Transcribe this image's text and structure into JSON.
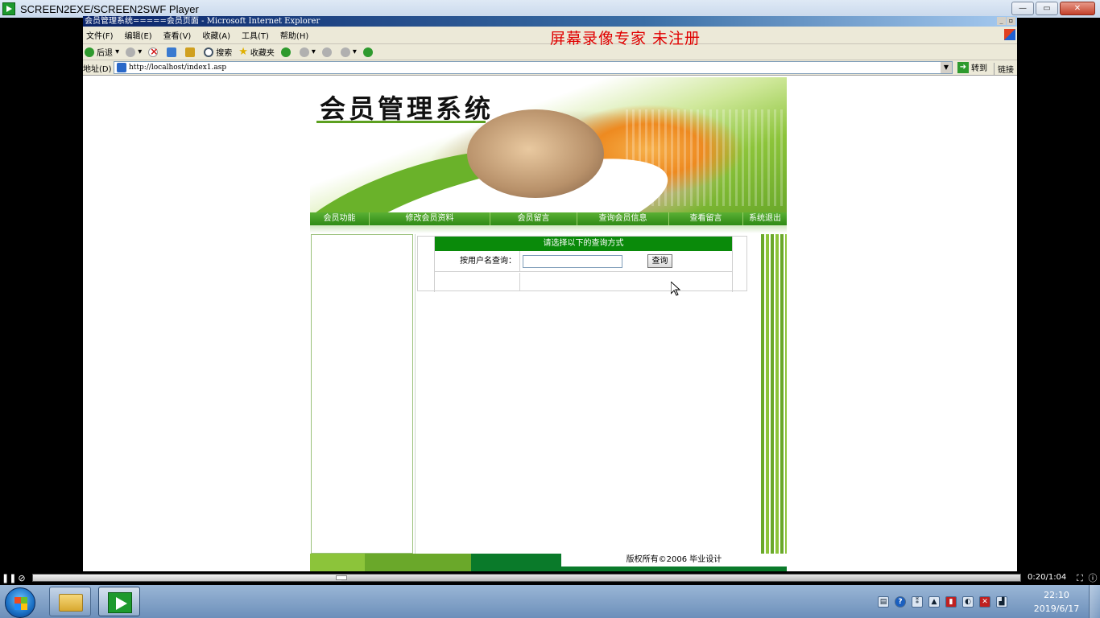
{
  "player": {
    "title": "SCREEN2EXE/SCREEN2SWF Player",
    "time": "0:20/1:04",
    "progress": 0.3125
  },
  "ie": {
    "title": "会员管理系统=====会员页面 - Microsoft Internet Explorer",
    "menu": [
      "文件(F)",
      "编辑(E)",
      "查看(V)",
      "收藏(A)",
      "工具(T)",
      "帮助(H)"
    ],
    "watermark": "屏幕录像专家 未注册",
    "toolbar": {
      "back": "后退",
      "search": "搜索",
      "favorites": "收藏夹"
    },
    "address_label": "地址(D)",
    "url": "http://localhost/index1.asp",
    "go": "转到",
    "links": "链接"
  },
  "page": {
    "banner_title": "会员管理系统",
    "nav": [
      "会员功能",
      "修改会员资料",
      "会员留言",
      "查询会员信息",
      "查看留言",
      "系统退出"
    ],
    "query": {
      "header": "请选择以下的查询方式",
      "label": "按用户名查询：",
      "input_value": "",
      "button": "查询"
    },
    "footer": "版权所有©2006  毕业设计"
  },
  "taskbar": {
    "time": "22:10",
    "date": "2019/6/17"
  }
}
